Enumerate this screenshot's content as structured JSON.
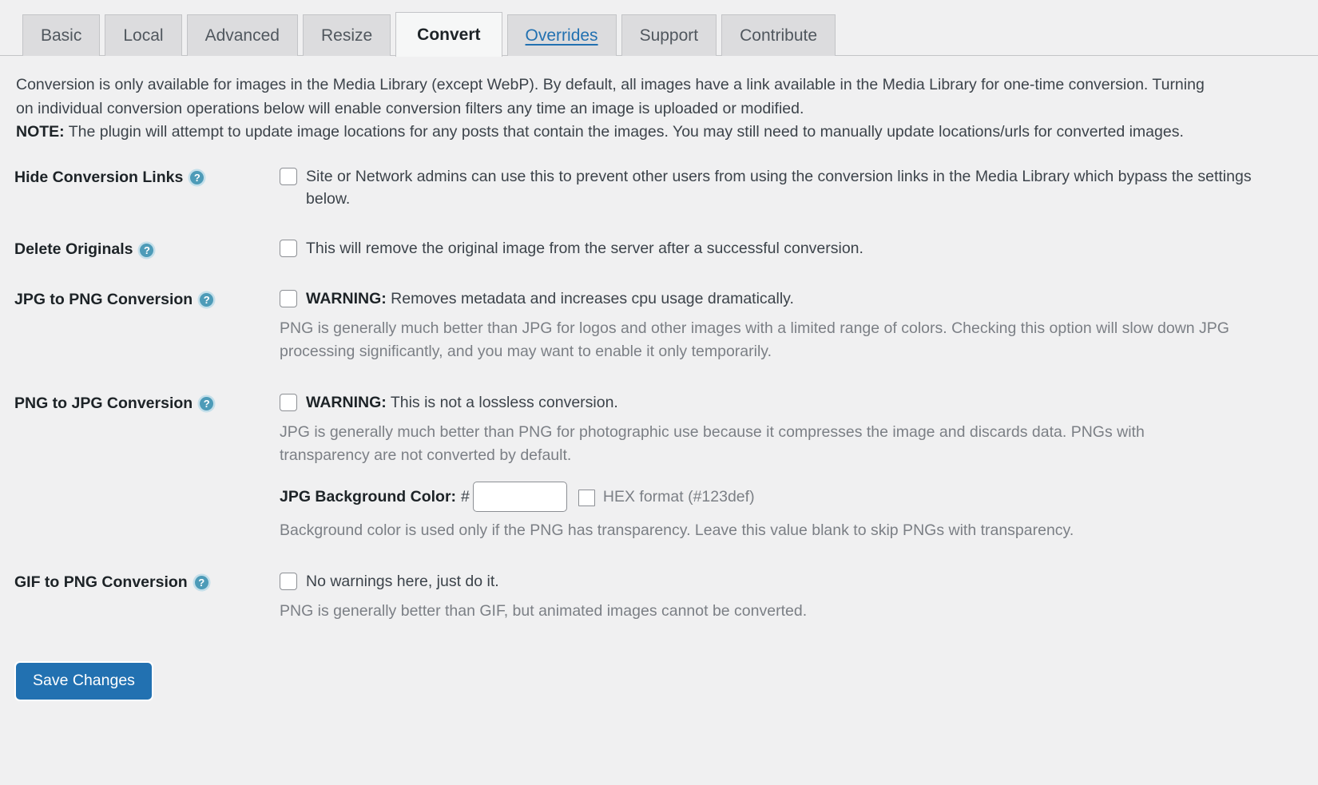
{
  "tabs": [
    {
      "label": "Basic",
      "state": "inactive"
    },
    {
      "label": "Local",
      "state": "inactive"
    },
    {
      "label": "Advanced",
      "state": "inactive"
    },
    {
      "label": "Resize",
      "state": "inactive"
    },
    {
      "label": "Convert",
      "state": "active"
    },
    {
      "label": "Overrides",
      "state": "link"
    },
    {
      "label": "Support",
      "state": "inactive"
    },
    {
      "label": "Contribute",
      "state": "inactive"
    }
  ],
  "intro": {
    "paragraph": "Conversion is only available for images in the Media Library (except WebP). By default, all images have a link available in the Media Library for one-time conversion. Turning on individual conversion operations below will enable conversion filters any time an image is uploaded or modified.",
    "note_label": "NOTE:",
    "note_text": " The plugin will attempt to update image locations for any posts that contain the images. You may still need to manually update locations/urls for converted images."
  },
  "help_icon": "question-mark-circle-icon",
  "rows": [
    {
      "label": "Hide Conversion Links",
      "checkbox_checked": false,
      "checkbox_text": "Site or Network admins can use this to prevent other users from using the conversion links in the Media Library which bypass the settings below.",
      "warning_prefix": "",
      "description": ""
    },
    {
      "label": "Delete Originals",
      "checkbox_checked": false,
      "checkbox_text": "This will remove the original image from the server after a successful conversion.",
      "warning_prefix": "",
      "description": ""
    },
    {
      "label": "JPG to PNG Conversion",
      "checkbox_checked": false,
      "warning_prefix": "WARNING:",
      "checkbox_text": " Removes metadata and increases cpu usage dramatically.",
      "description": "PNG is generally much better than JPG for logos and other images with a limited range of colors. Checking this option will slow down JPG processing significantly, and you may want to enable it only temporarily."
    },
    {
      "label": "PNG to JPG Conversion",
      "checkbox_checked": false,
      "warning_prefix": "WARNING:",
      "checkbox_text": " This is not a lossless conversion.",
      "description": "JPG is generally much better than PNG for photographic use because it compresses the image and discards data. PNGs with transparency are not converted by default."
    },
    {
      "label": "GIF to PNG Conversion",
      "checkbox_checked": false,
      "warning_prefix": "",
      "checkbox_text": "No warnings here, just do it.",
      "description": "PNG is generally better than GIF, but animated images cannot be converted."
    }
  ],
  "jpg_background": {
    "label": "JPG Background Color:",
    "hash": "#",
    "value": "",
    "placeholder": "",
    "hex_checkbox_checked": false,
    "hex_note": "HEX format (#123def)",
    "helper_text": "Background color is used only if the PNG has transparency. Leave this value blank to skip PNGs with transparency."
  },
  "save_button": {
    "label": "Save Changes"
  },
  "colors": {
    "page_background": "#f0f0f1",
    "tab_inactive": "#dcdcde",
    "tab_active": "#f6f7f7",
    "accent_blue": "#2271b1",
    "help_icon": "#4d9bb8",
    "body_text": "#3c434a",
    "muted_text": "#7b7f85"
  }
}
